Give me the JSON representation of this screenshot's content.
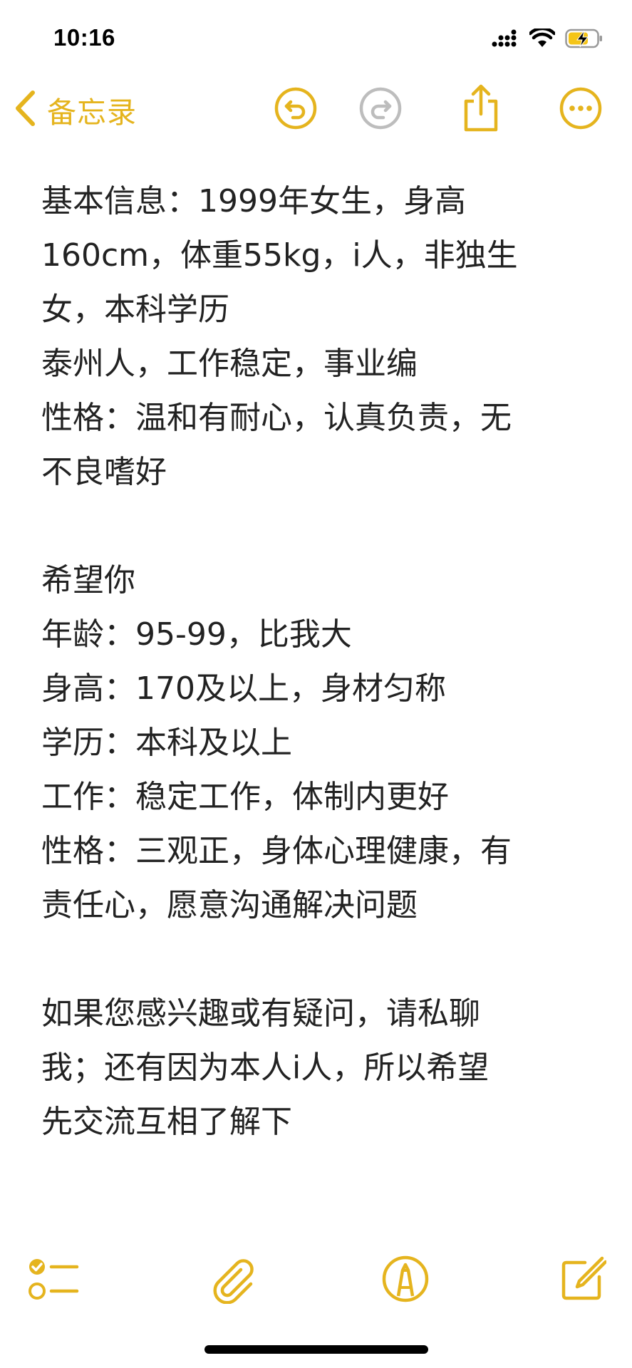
{
  "status_bar": {
    "time": "10:16",
    "icons": [
      "cellular-signal-icon",
      "wifi-icon",
      "battery-charging-icon"
    ]
  },
  "nav": {
    "back_label": "备忘录",
    "icons": [
      "undo-icon",
      "redo-icon",
      "share-icon",
      "more-icon"
    ]
  },
  "note": {
    "lines": [
      "基本信息：1999年女生，身高",
      "160cm，体重55kg，i人，非独生",
      "女，本科学历",
      "泰州人，工作稳定，事业编",
      "性格：温和有耐心，认真负责，无",
      "不良嗜好",
      "",
      "希望你",
      "年龄：95-99，比我大",
      "身高：170及以上，身材匀称",
      "学历：本科及以上",
      "工作：稳定工作，体制内更好",
      "性格：三观正，身体心理健康，有",
      "责任心，愿意沟通解决问题",
      "",
      "如果您感兴趣或有疑问，请私聊",
      "我；还有因为本人i人，所以希望",
      "先交流互相了解下"
    ]
  },
  "toolbar": {
    "icons": [
      "checklist-icon",
      "paperclip-icon",
      "markup-pen-icon",
      "compose-icon"
    ]
  },
  "colors": {
    "accent": "#E5B41E",
    "accent_disabled": "#BDBDBD",
    "text": "#222222"
  }
}
